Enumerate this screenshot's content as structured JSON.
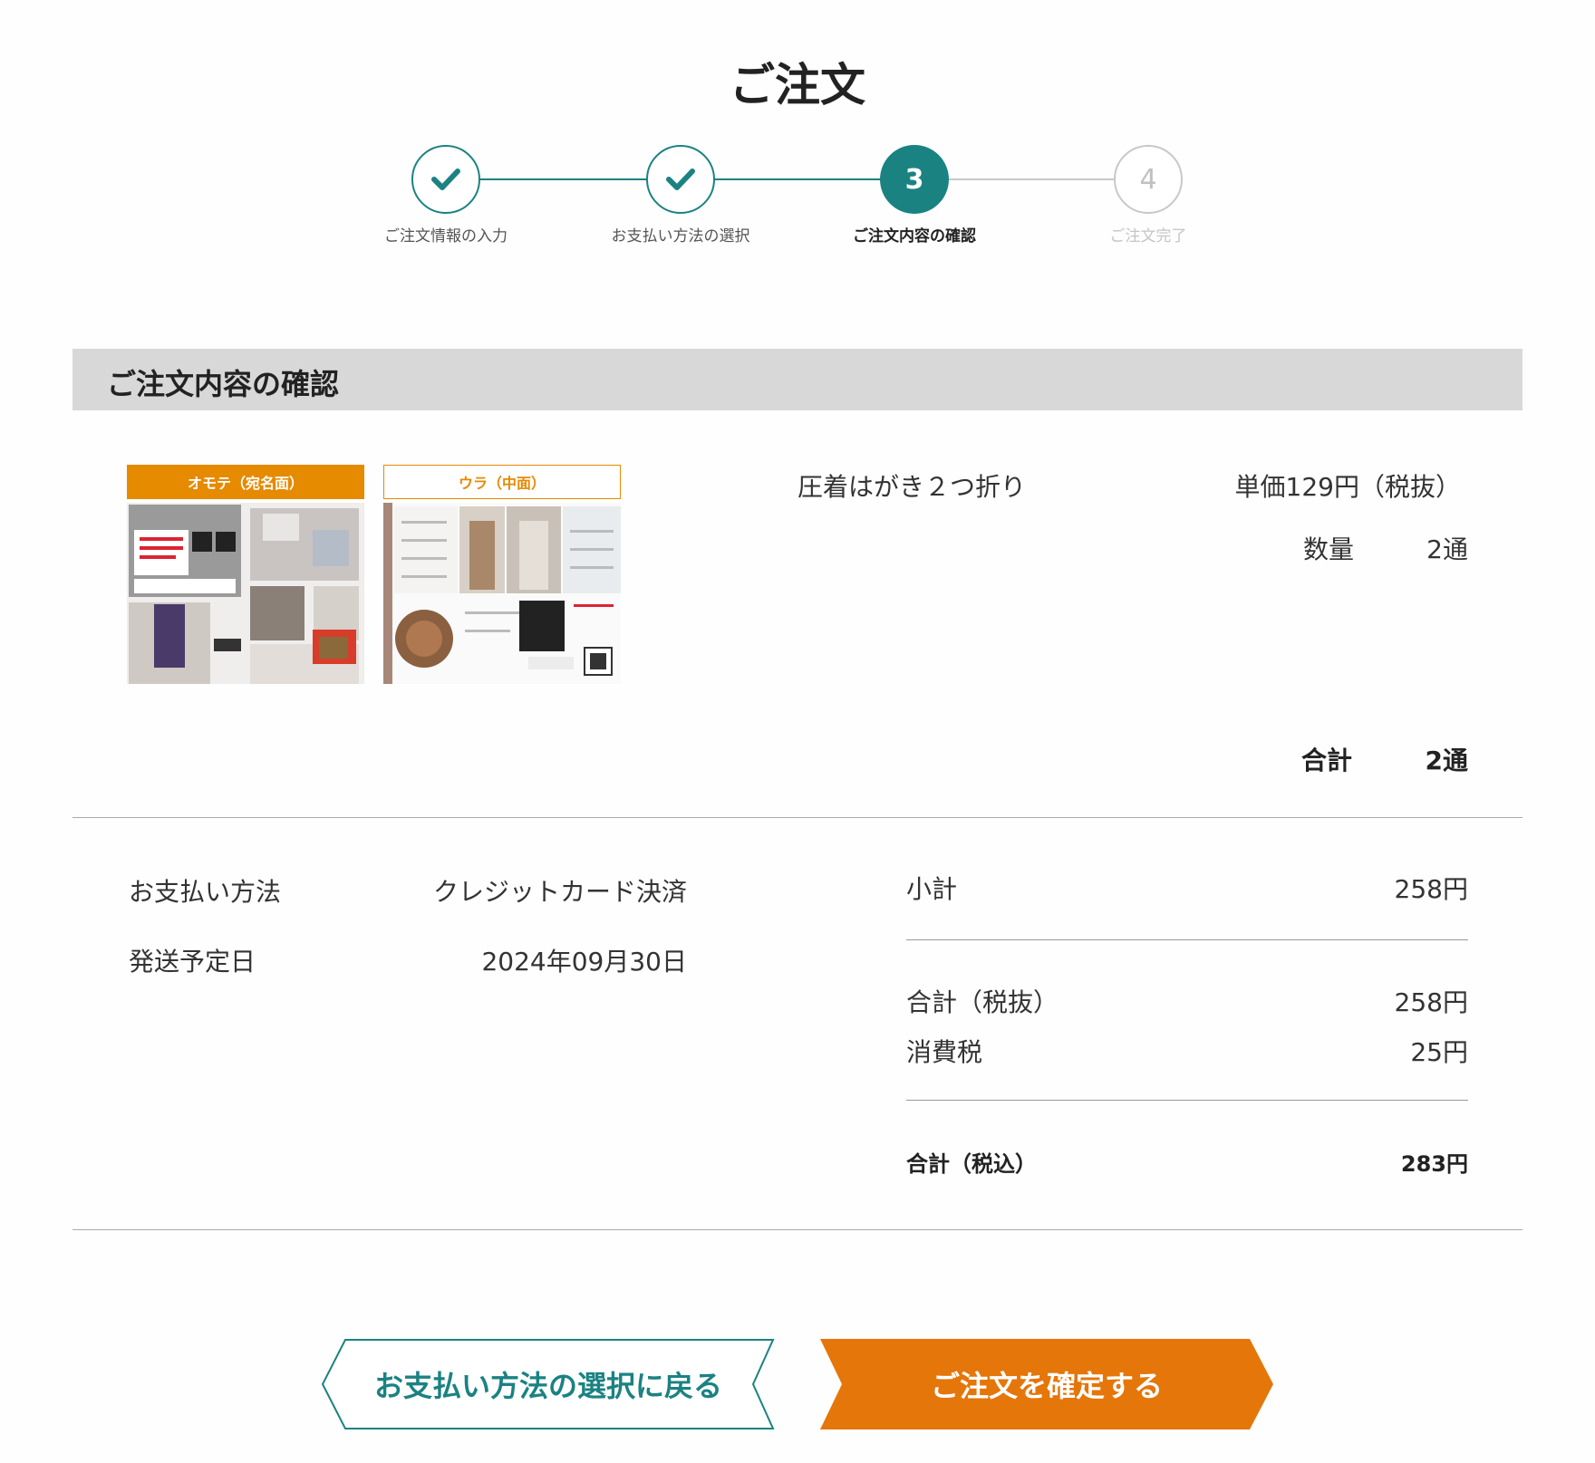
{
  "page": {
    "title": "ご注文"
  },
  "stepper": {
    "steps": [
      {
        "number": "",
        "label": "ご注文情報の入力",
        "state": "done"
      },
      {
        "number": "",
        "label": "お支払い方法の選択",
        "state": "done"
      },
      {
        "number": "3",
        "label": "ご注文内容の確認",
        "state": "active"
      },
      {
        "number": "4",
        "label": "ご注文完了",
        "state": "todo"
      }
    ]
  },
  "section": {
    "title": "ご注文内容の確認"
  },
  "order_item": {
    "thumbnails": [
      {
        "label": "オモテ（宛名面）",
        "style": "front"
      },
      {
        "label": "ウラ（中面）",
        "style": "back"
      }
    ],
    "product_name": "圧着はがき２つ折り",
    "unit_price": "単価129円（税抜）",
    "quantity_label": "数量",
    "quantity_value": "2通",
    "total_label": "合計",
    "total_value": "2通"
  },
  "order_info": {
    "payment_label": "お支払い方法",
    "payment_value": "クレジットカード決済",
    "shipping_label": "発送予定日",
    "shipping_value": "2024年09月30日"
  },
  "summary": {
    "subtotal_label": "小計",
    "subtotal_value": "258円",
    "total_excl_label": "合計（税抜）",
    "total_excl_value": "258円",
    "tax_label": "消費税",
    "tax_value": "25円",
    "total_incl_label": "合計（税込）",
    "total_incl_value": "283円"
  },
  "buttons": {
    "back_label": "お支払い方法の選択に戻る",
    "confirm_label": "ご注文を確定する"
  },
  "colors": {
    "accent": "#1b8282",
    "orange": "#e68a00",
    "confirm": "#e5760a"
  },
  "icons": {
    "done_step": "checkmark-icon"
  }
}
